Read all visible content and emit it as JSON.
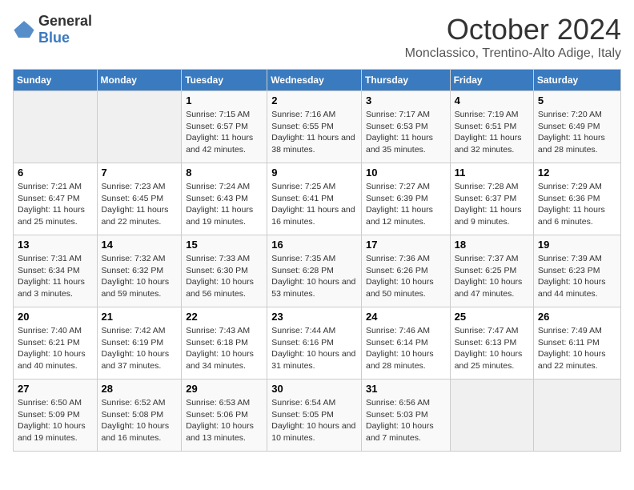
{
  "logo": {
    "general": "General",
    "blue": "Blue"
  },
  "header": {
    "month": "October 2024",
    "location": "Monclassico, Trentino-Alto Adige, Italy"
  },
  "days_of_week": [
    "Sunday",
    "Monday",
    "Tuesday",
    "Wednesday",
    "Thursday",
    "Friday",
    "Saturday"
  ],
  "weeks": [
    [
      {
        "day": "",
        "empty": true
      },
      {
        "day": "",
        "empty": true
      },
      {
        "day": "1",
        "sunrise": "7:15 AM",
        "sunset": "6:57 PM",
        "daylight": "11 hours and 42 minutes."
      },
      {
        "day": "2",
        "sunrise": "7:16 AM",
        "sunset": "6:55 PM",
        "daylight": "11 hours and 38 minutes."
      },
      {
        "day": "3",
        "sunrise": "7:17 AM",
        "sunset": "6:53 PM",
        "daylight": "11 hours and 35 minutes."
      },
      {
        "day": "4",
        "sunrise": "7:19 AM",
        "sunset": "6:51 PM",
        "daylight": "11 hours and 32 minutes."
      },
      {
        "day": "5",
        "sunrise": "7:20 AM",
        "sunset": "6:49 PM",
        "daylight": "11 hours and 28 minutes."
      }
    ],
    [
      {
        "day": "6",
        "sunrise": "7:21 AM",
        "sunset": "6:47 PM",
        "daylight": "11 hours and 25 minutes."
      },
      {
        "day": "7",
        "sunrise": "7:23 AM",
        "sunset": "6:45 PM",
        "daylight": "11 hours and 22 minutes."
      },
      {
        "day": "8",
        "sunrise": "7:24 AM",
        "sunset": "6:43 PM",
        "daylight": "11 hours and 19 minutes."
      },
      {
        "day": "9",
        "sunrise": "7:25 AM",
        "sunset": "6:41 PM",
        "daylight": "11 hours and 16 minutes."
      },
      {
        "day": "10",
        "sunrise": "7:27 AM",
        "sunset": "6:39 PM",
        "daylight": "11 hours and 12 minutes."
      },
      {
        "day": "11",
        "sunrise": "7:28 AM",
        "sunset": "6:37 PM",
        "daylight": "11 hours and 9 minutes."
      },
      {
        "day": "12",
        "sunrise": "7:29 AM",
        "sunset": "6:36 PM",
        "daylight": "11 hours and 6 minutes."
      }
    ],
    [
      {
        "day": "13",
        "sunrise": "7:31 AM",
        "sunset": "6:34 PM",
        "daylight": "11 hours and 3 minutes."
      },
      {
        "day": "14",
        "sunrise": "7:32 AM",
        "sunset": "6:32 PM",
        "daylight": "10 hours and 59 minutes."
      },
      {
        "day": "15",
        "sunrise": "7:33 AM",
        "sunset": "6:30 PM",
        "daylight": "10 hours and 56 minutes."
      },
      {
        "day": "16",
        "sunrise": "7:35 AM",
        "sunset": "6:28 PM",
        "daylight": "10 hours and 53 minutes."
      },
      {
        "day": "17",
        "sunrise": "7:36 AM",
        "sunset": "6:26 PM",
        "daylight": "10 hours and 50 minutes."
      },
      {
        "day": "18",
        "sunrise": "7:37 AM",
        "sunset": "6:25 PM",
        "daylight": "10 hours and 47 minutes."
      },
      {
        "day": "19",
        "sunrise": "7:39 AM",
        "sunset": "6:23 PM",
        "daylight": "10 hours and 44 minutes."
      }
    ],
    [
      {
        "day": "20",
        "sunrise": "7:40 AM",
        "sunset": "6:21 PM",
        "daylight": "10 hours and 40 minutes."
      },
      {
        "day": "21",
        "sunrise": "7:42 AM",
        "sunset": "6:19 PM",
        "daylight": "10 hours and 37 minutes."
      },
      {
        "day": "22",
        "sunrise": "7:43 AM",
        "sunset": "6:18 PM",
        "daylight": "10 hours and 34 minutes."
      },
      {
        "day": "23",
        "sunrise": "7:44 AM",
        "sunset": "6:16 PM",
        "daylight": "10 hours and 31 minutes."
      },
      {
        "day": "24",
        "sunrise": "7:46 AM",
        "sunset": "6:14 PM",
        "daylight": "10 hours and 28 minutes."
      },
      {
        "day": "25",
        "sunrise": "7:47 AM",
        "sunset": "6:13 PM",
        "daylight": "10 hours and 25 minutes."
      },
      {
        "day": "26",
        "sunrise": "7:49 AM",
        "sunset": "6:11 PM",
        "daylight": "10 hours and 22 minutes."
      }
    ],
    [
      {
        "day": "27",
        "sunrise": "6:50 AM",
        "sunset": "5:09 PM",
        "daylight": "10 hours and 19 minutes."
      },
      {
        "day": "28",
        "sunrise": "6:52 AM",
        "sunset": "5:08 PM",
        "daylight": "10 hours and 16 minutes."
      },
      {
        "day": "29",
        "sunrise": "6:53 AM",
        "sunset": "5:06 PM",
        "daylight": "10 hours and 13 minutes."
      },
      {
        "day": "30",
        "sunrise": "6:54 AM",
        "sunset": "5:05 PM",
        "daylight": "10 hours and 10 minutes."
      },
      {
        "day": "31",
        "sunrise": "6:56 AM",
        "sunset": "5:03 PM",
        "daylight": "10 hours and 7 minutes."
      },
      {
        "day": "",
        "empty": true
      },
      {
        "day": "",
        "empty": true
      }
    ]
  ],
  "labels": {
    "sunrise": "Sunrise:",
    "sunset": "Sunset:",
    "daylight": "Daylight:"
  }
}
